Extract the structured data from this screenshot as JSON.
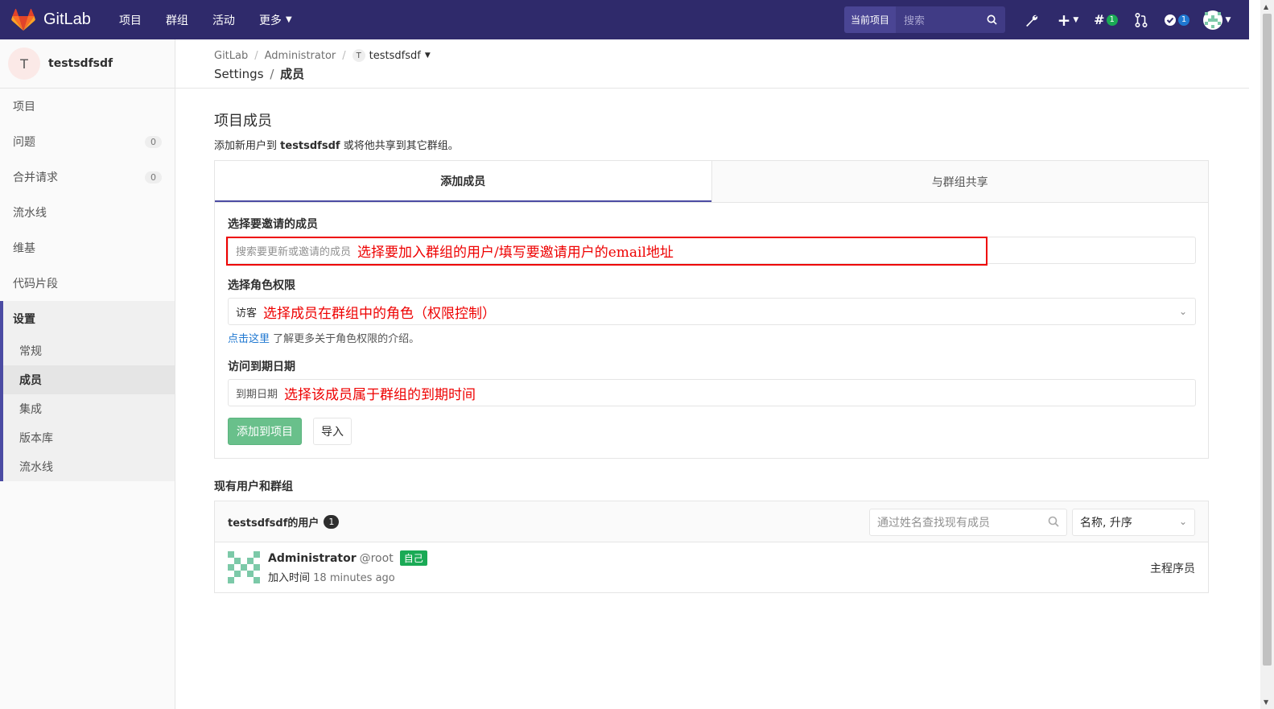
{
  "navbar": {
    "brand": "GitLab",
    "links": [
      {
        "label": "项目"
      },
      {
        "label": "群组"
      },
      {
        "label": "活动"
      },
      {
        "label": "更多"
      }
    ],
    "search_scope": "当前项目",
    "search_placeholder": "搜索",
    "todos_count": "1",
    "issues_count": "1",
    "colors": {
      "bg": "#2f2a6b",
      "badge_green": "#1aaa55",
      "badge_blue": "#1f78d1"
    }
  },
  "sidebar": {
    "project_initial": "T",
    "project_name": "testsdfsdf",
    "items": [
      {
        "label": "项目",
        "count": ""
      },
      {
        "label": "问题",
        "count": "0"
      },
      {
        "label": "合并请求",
        "count": "0"
      },
      {
        "label": "流水线",
        "count": ""
      },
      {
        "label": "维基",
        "count": ""
      },
      {
        "label": "代码片段",
        "count": ""
      }
    ],
    "settings_label": "设置",
    "settings_items": [
      {
        "label": "常规"
      },
      {
        "label": "成员"
      },
      {
        "label": "集成"
      },
      {
        "label": "版本库"
      },
      {
        "label": "流水线"
      }
    ]
  },
  "breadcrumb": {
    "items": [
      "GitLab",
      "Administrator"
    ],
    "project_initial": "T",
    "project": "testsdfsdf",
    "section": "Settings",
    "page": "成员"
  },
  "main": {
    "title": "项目成员",
    "desc_pre": "添加新用户到",
    "desc_project": "testsdfsdf",
    "desc_post": "或将他共享到其它群组。",
    "tabs": [
      {
        "label": "添加成员"
      },
      {
        "label": "与群组共享"
      }
    ],
    "invite": {
      "label": "选择要邀请的成员",
      "placeholder": "搜索要更新或邀请的成员",
      "annotation": "选择要加入群组的用户/填写要邀请用户的email地址"
    },
    "role": {
      "label": "选择角色权限",
      "value": "访客",
      "annotation": "选择成员在群组中的角色（权限控制）",
      "help_link": "点击这里",
      "help_text": "了解更多关于角色权限的介绍。"
    },
    "expiry": {
      "label": "访问到期日期",
      "placeholder": "到期日期",
      "annotation": "选择该成员属于群组的到期时间"
    },
    "add_button": "添加到项目",
    "import_button": "导入",
    "existing_title": "现有用户和群组",
    "members_header": "testsdfsdf的用户",
    "members_count": "1",
    "find_placeholder": "通过姓名查找现有成员",
    "sort_value": "名称, 升序",
    "members": [
      {
        "name": "Administrator",
        "handle": "@root",
        "badge": "自己",
        "joined_label": "加入时间",
        "joined_time": "18 minutes ago",
        "role": "主程序员"
      }
    ]
  }
}
